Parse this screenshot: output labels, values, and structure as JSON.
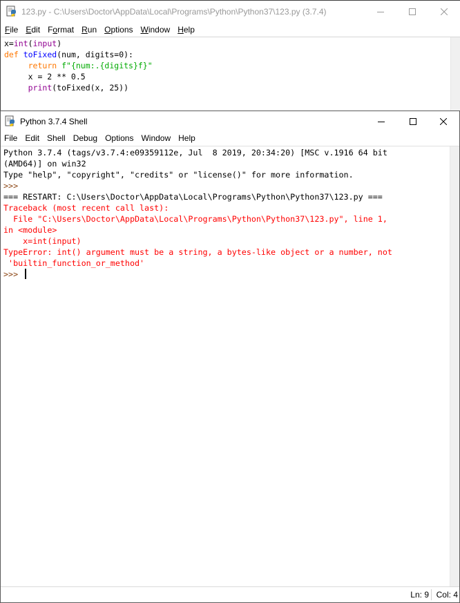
{
  "editor": {
    "title": "123.py - C:\\Users\\Doctor\\AppData\\Local\\Programs\\Python\\Python37\\123.py (3.7.4)",
    "menu": [
      {
        "u": "F",
        "rest": "ile"
      },
      {
        "u": "E",
        "rest": "dit"
      },
      {
        "pre": "F",
        "u": "o",
        "rest": "rmat"
      },
      {
        "u": "R",
        "rest": "un"
      },
      {
        "u": "O",
        "rest": "ptions"
      },
      {
        "u": "W",
        "rest": "indow"
      },
      {
        "u": "H",
        "rest": "elp"
      }
    ],
    "code": {
      "l1_a": "x=",
      "l1_b": "int",
      "l1_c": "(",
      "l1_d": "input",
      "l1_e": ")",
      "l2_a": "def",
      "l2_b": " ",
      "l2_c": "toFixed",
      "l2_d": "(num, digits=0):",
      "l3_a": "     ",
      "l3_b": "return",
      "l3_c": " ",
      "l3_d": "f\"{num:.{digits}f}\"",
      "l4": "     x = 2 ** 0.5",
      "l5_a": "     ",
      "l5_b": "print",
      "l5_c": "(toFixed(x, 25))"
    }
  },
  "shell": {
    "title": "Python 3.7.4 Shell",
    "menu": [
      "File",
      "Edit",
      "Shell",
      "Debug",
      "Options",
      "Window",
      "Help"
    ],
    "lines": {
      "banner1": "Python 3.7.4 (tags/v3.7.4:e09359112e, Jul  8 2019, 20:34:20) [MSC v.1916 64 bit",
      "banner2": "(AMD64)] on win32",
      "banner3": "Type \"help\", \"copyright\", \"credits\" or \"license()\" for more information.",
      "prompt": ">>> ",
      "restart": "=== RESTART: C:\\Users\\Doctor\\AppData\\Local\\Programs\\Python\\Python37\\123.py ===",
      "tb1": "Traceback (most recent call last):",
      "tb2": "  File \"C:\\Users\\Doctor\\AppData\\Local\\Programs\\Python\\Python37\\123.py\", line 1,",
      "tb3": "in <module>",
      "tb4": "    x=int(input)",
      "tb5": "TypeError: int() argument must be a string, a bytes-like object or a number, not",
      "tb6": " 'builtin_function_or_method'"
    },
    "status": {
      "ln": "Ln: 9",
      "col": "Col: 4"
    }
  },
  "colors": {
    "keyword": "#ff7700",
    "builtin": "#900090",
    "def_name": "#0000ff",
    "string": "#00aa00",
    "prompt": "#8b4513",
    "error": "#ff0000"
  },
  "icons": [
    "python-idle-icon",
    "minimize-icon",
    "maximize-icon",
    "close-icon"
  ]
}
